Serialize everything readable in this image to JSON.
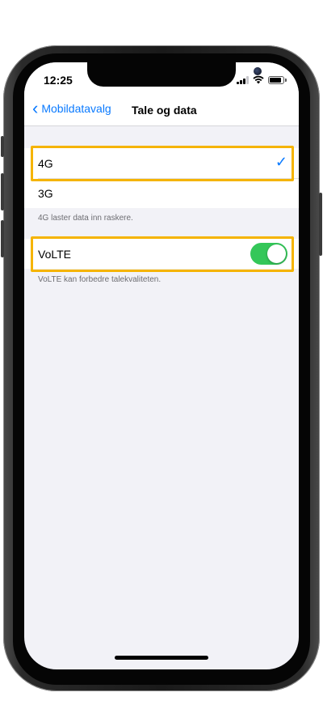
{
  "status_bar": {
    "time": "12:25",
    "icons": [
      "signal-icon",
      "wifi-icon",
      "battery-icon"
    ]
  },
  "navbar": {
    "back_label": "Mobildatavalg",
    "back_icon": "chevron-left-icon",
    "title": "Tale og data"
  },
  "voice_data": {
    "options": [
      {
        "label": "4G",
        "selected": true
      },
      {
        "label": "3G",
        "selected": false
      }
    ],
    "footer": "4G laster data inn raskere."
  },
  "volte": {
    "label": "VoLTE",
    "enabled": true,
    "footer": "VoLTE kan forbedre talekvaliteten."
  },
  "colors": {
    "accent": "#0a7aff",
    "toggle_on": "#34c759",
    "highlight": "#f5b400",
    "grouped_background": "#f2f2f7"
  }
}
